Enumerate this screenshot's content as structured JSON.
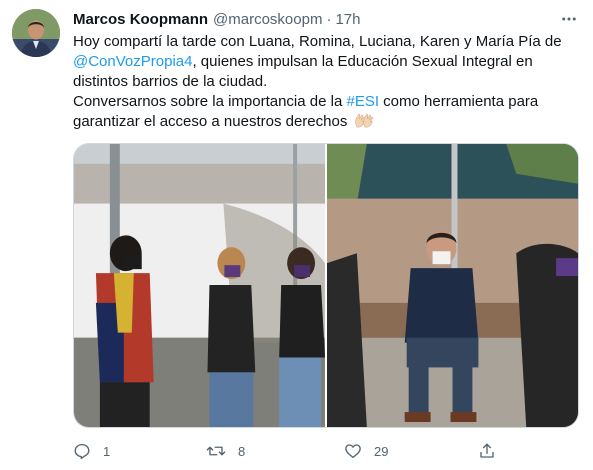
{
  "tweet": {
    "author": {
      "display_name": "Marcos Koopmann",
      "handle": "@marcoskoopm",
      "time": "17h"
    },
    "text": {
      "line1": "Hoy compartí la tarde con Luana, Romina, Luciana, Karen y María Pía de",
      "mention": "@ConVozPropia4",
      "line2_rest": ", quienes impulsan la Educación Sexual Integral en distintos barrios de la ciudad.",
      "line3_pre": "Conversarnos sobre la importancia de la ",
      "hashtag": "#ESI",
      "line3_post": " como herramienta para garantizar el acceso a nuestros derechos"
    },
    "media": {
      "photos": [
        "photo-1",
        "photo-2"
      ]
    },
    "actions": {
      "reply_count": "1",
      "retweet_count": "8",
      "like_count": "29"
    },
    "icons": {
      "more": "more-icon",
      "reply": "reply-icon",
      "retweet": "retweet-icon",
      "like": "heart-icon",
      "share": "share-icon",
      "emoji": "clapping-hands-emoji"
    },
    "colors": {
      "link": "#1d9bf0",
      "secondary_text": "#536471",
      "border": "#cfd9de"
    }
  }
}
